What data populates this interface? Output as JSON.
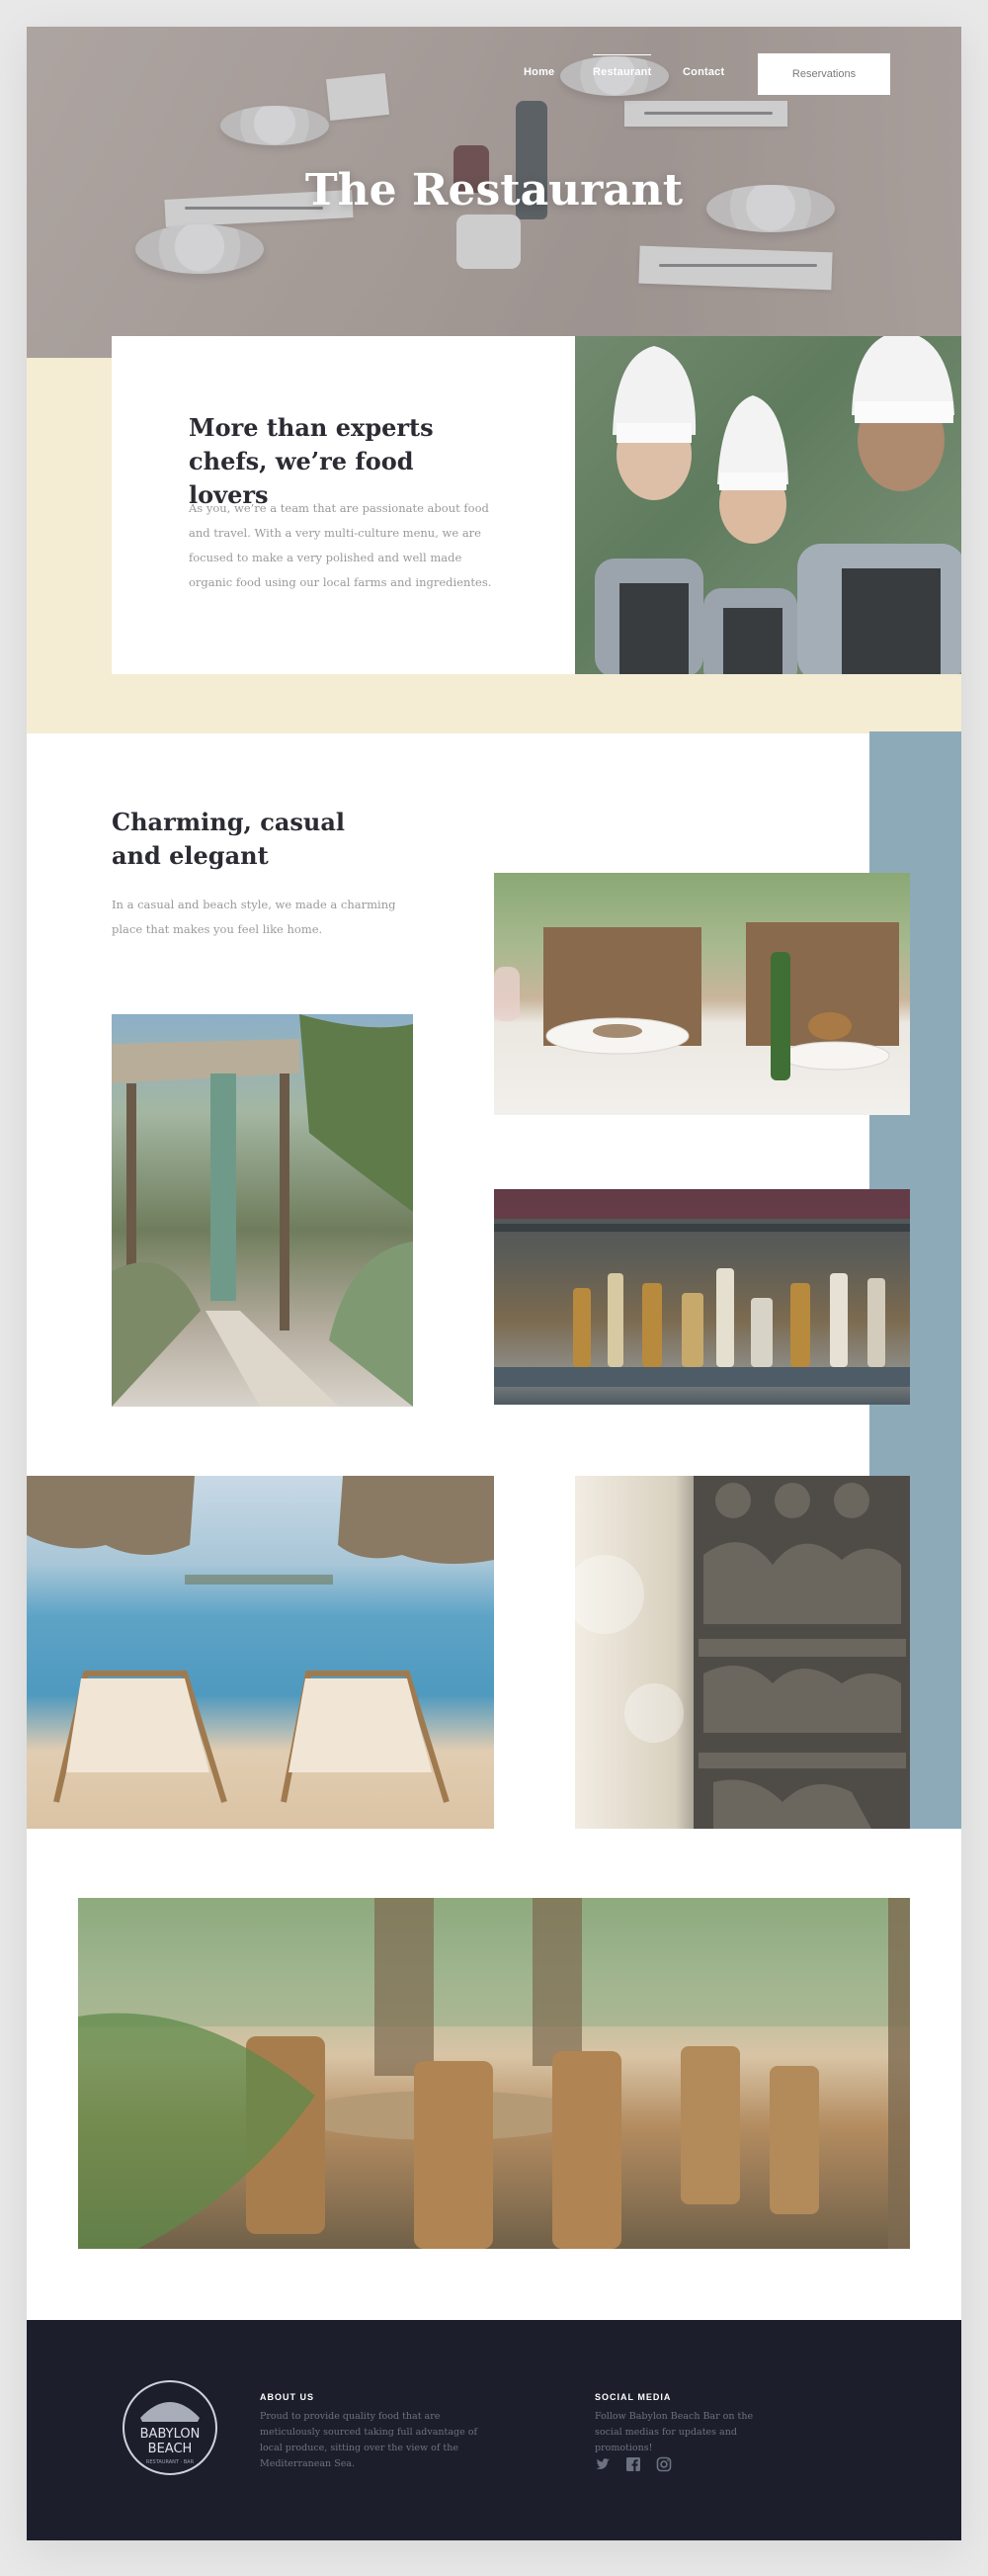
{
  "nav": {
    "items": [
      {
        "label": "Home"
      },
      {
        "label": "Restaurant",
        "active": true
      },
      {
        "label": "Contact"
      }
    ],
    "reservations_label": "Reservations"
  },
  "hero": {
    "title": "The Restaurant"
  },
  "intro": {
    "heading": "More than experts chefs, we’re food lovers",
    "text": "As you, we’re a team that are passionate about food and travel. With a very multi-culture menu, we are focused to make a very polished and well made organic food using our local farms and ingredientes."
  },
  "charming": {
    "heading": "Charming, casual and elegant",
    "text": "In a casual and beach style, we made a charming place that makes you feel like home."
  },
  "footer": {
    "logo": {
      "line1": "BABYLON",
      "line2": "BEACH",
      "tagline": "RESTAURANT · BAR"
    },
    "about": {
      "heading": "ABOUT US",
      "text": "Proud to provide quality food that are meticulously sourced taking full advantage of local produce, sitting over the view of the Mediterranean Sea."
    },
    "social": {
      "heading": "SOCIAL MEDIA",
      "text": "Follow Babylon Beach Bar on the social medias for updates and promotions!",
      "icons": [
        "twitter-icon",
        "facebook-icon",
        "instagram-icon"
      ]
    }
  },
  "colors": {
    "cream": "#f4ecd3",
    "steel_blue": "#8daab9",
    "footer_bg": "#1c1f2b",
    "heading": "#2b2b33",
    "body_text": "#9a9a9a"
  }
}
